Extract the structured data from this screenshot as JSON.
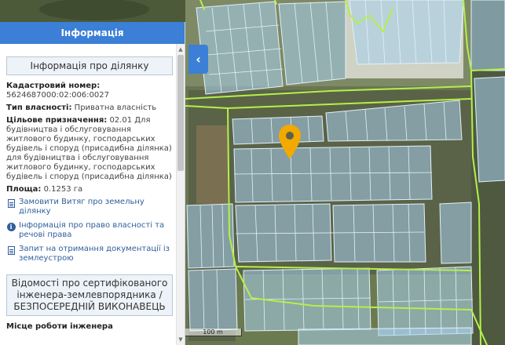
{
  "panel": {
    "header": "Інформація",
    "collapse_icon": "chevron-left-icon",
    "section_title": "Інформація про ділянку",
    "cadastral_label": "Кадастровий номер:",
    "cadastral_value": "5624687000:02:006:0027",
    "ownership_label": "Тип власності:",
    "ownership_value": "Приватна власність",
    "purpose_label": "Цільове призначення:",
    "purpose_value": "02.01 Для будівництва і обслуговування житлового будинку, господарських будівель і споруд (присадибна ділянка) для будівництва і обслуговування житлового будинку, господарських будівель і споруд (присадибна ділянка)",
    "area_label": "Площа:",
    "area_value": "0.1253 га",
    "links": [
      {
        "icon": "document-icon",
        "label": "Замовити Витяг про земельну ділянку"
      },
      {
        "icon": "info-circle-icon",
        "label": "Інформація про право власності та речові права"
      },
      {
        "icon": "document-icon",
        "label": "Запит на отримання документації із землеустрою"
      }
    ],
    "engineer_title": "Відомості про сертифікованого інженера-землевпорядника / БЕЗПОСЕРЕДНІЙ ВИКОНАВЕЦЬ",
    "cut_label": "Місце роботи інженера"
  },
  "map": {
    "scale_label": "100 m",
    "marker_icon": "map-pin-icon",
    "marker_color": "#f2a900",
    "parcel_fill": "#a7cfee",
    "parcel_stroke": "#e3f1fb",
    "boundary_color": "#b4f04a"
  },
  "colors": {
    "accent": "#3b7fd6",
    "link": "#2f5e9c"
  }
}
